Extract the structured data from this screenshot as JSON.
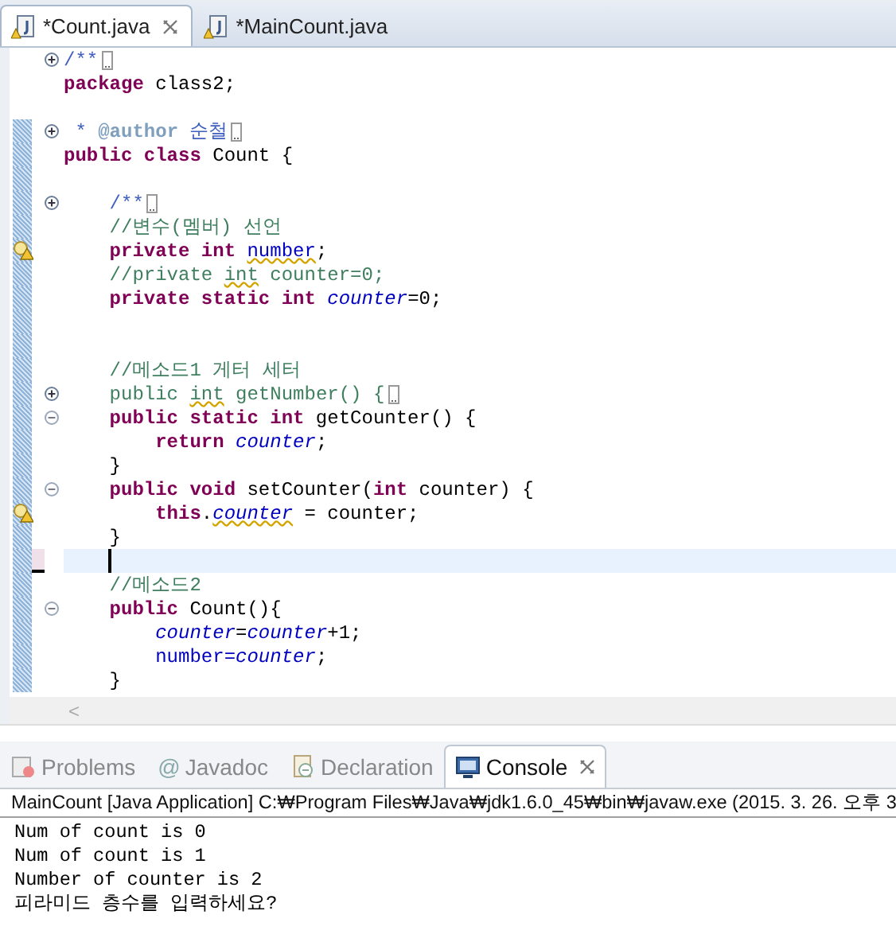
{
  "editor_tabs": [
    {
      "label": "*Count.java",
      "selected": true,
      "closable": true
    },
    {
      "label": "*MainCount.java",
      "selected": false,
      "closable": false
    }
  ],
  "code_lines": [
    {
      "fold": {
        "expanded": false
      },
      "changed": false,
      "tokens": [
        {
          "text": "/**",
          "kind": "javadoc"
        }
      ]
    },
    {
      "changed": false,
      "tokens": [
        {
          "text": "package",
          "kind": "keyword"
        },
        {
          "text": " class2;",
          "kind": "plain"
        }
      ]
    },
    {
      "changed": false
    },
    {
      "fold": {
        "expanded": false
      },
      "changed": true,
      "tokens": [
        {
          "text": " * ",
          "kind": "javadoc"
        },
        {
          "text": "@author",
          "kind": "tag"
        },
        {
          "text": " 순철",
          "kind": "javadoc"
        }
      ]
    },
    {
      "changed": true,
      "tokens": [
        {
          "text": "public class",
          "kind": "keyword"
        },
        {
          "text": " Count {",
          "kind": "plain"
        }
      ]
    },
    {
      "changed": true
    },
    {
      "fold": {
        "expanded": false
      },
      "changed": true,
      "tokens": [
        {
          "text": "    /**",
          "kind": "javadoc"
        }
      ]
    },
    {
      "changed": true,
      "tokens": [
        {
          "text": "    //변수(멤버) 선언",
          "kind": "comment"
        }
      ]
    },
    {
      "changed": true,
      "warning": true,
      "tokens": [
        {
          "text": "    private int ",
          "kind": "keyword"
        },
        {
          "text": "number",
          "kind": "field",
          "squiggle": true
        },
        {
          "text": ";",
          "kind": "plain"
        }
      ]
    },
    {
      "changed": true,
      "tokens": [
        {
          "text": "    //private ",
          "kind": "comment"
        },
        {
          "text": "int",
          "kind": "comment",
          "squiggle": true
        },
        {
          "text": " counter=0;",
          "kind": "comment"
        }
      ]
    },
    {
      "changed": true,
      "tokens": [
        {
          "text": "    private static int ",
          "kind": "keyword"
        },
        {
          "text": "counter",
          "kind": "static"
        },
        {
          "text": "=0;",
          "kind": "plain"
        }
      ]
    },
    {
      "changed": true
    },
    {
      "changed": true
    },
    {
      "changed": true,
      "tokens": [
        {
          "text": "    //메소드1 게터 세터",
          "kind": "comment"
        }
      ]
    },
    {
      "fold": {
        "expanded": false
      },
      "changed": true,
      "tokens": [
        {
          "text": "    public ",
          "kind": "comment"
        },
        {
          "text": "int",
          "kind": "comment",
          "squiggle": true
        },
        {
          "text": " getNumber() {",
          "kind": "comment"
        }
      ]
    },
    {
      "fold": {
        "expanded": true
      },
      "changed": true,
      "tokens": [
        {
          "text": "    public static int",
          "kind": "keyword"
        },
        {
          "text": " getCounter() {",
          "kind": "plain"
        }
      ]
    },
    {
      "changed": true,
      "tokens": [
        {
          "text": "        return ",
          "kind": "keyword"
        },
        {
          "text": "counter",
          "kind": "static"
        },
        {
          "text": ";",
          "kind": "plain"
        }
      ]
    },
    {
      "changed": true,
      "tokens": [
        {
          "text": "    }",
          "kind": "plain"
        }
      ]
    },
    {
      "fold": {
        "expanded": true
      },
      "changed": true,
      "tokens": [
        {
          "text": "    public void",
          "kind": "keyword"
        },
        {
          "text": " setCounter(",
          "kind": "plain"
        },
        {
          "text": "int",
          "kind": "keyword"
        },
        {
          "text": " counter) {",
          "kind": "plain"
        }
      ]
    },
    {
      "changed": true,
      "warning": true,
      "tokens": [
        {
          "text": "        this",
          "kind": "keyword"
        },
        {
          "text": ".",
          "kind": "plain"
        },
        {
          "text": "counter",
          "kind": "static",
          "squiggle": true
        },
        {
          "text": " = counter;",
          "kind": "plain"
        }
      ]
    },
    {
      "changed": true,
      "tokens": [
        {
          "text": "    }",
          "kind": "plain"
        }
      ]
    },
    {
      "changed": true,
      "current": true
    },
    {
      "changed": true,
      "tokens": [
        {
          "text": "    //메소드2",
          "kind": "comment"
        }
      ]
    },
    {
      "fold": {
        "expanded": true
      },
      "changed": true,
      "tokens": [
        {
          "text": "    public",
          "kind": "keyword"
        },
        {
          "text": " Count(){",
          "kind": "plain"
        }
      ]
    },
    {
      "changed": true,
      "tokens": [
        {
          "text": "        counter",
          "kind": "static"
        },
        {
          "text": "=",
          "kind": "plain"
        },
        {
          "text": "counter",
          "kind": "static"
        },
        {
          "text": "+1;",
          "kind": "plain"
        }
      ]
    },
    {
      "changed": true,
      "tokens": [
        {
          "text": "        number=",
          "kind": "field"
        },
        {
          "text": "counter",
          "kind": "static"
        },
        {
          "text": ";",
          "kind": "plain"
        }
      ]
    },
    {
      "changed": true,
      "tokens": [
        {
          "text": "    }",
          "kind": "plain"
        }
      ]
    }
  ],
  "scrollbar": {
    "left_arrow": "<"
  },
  "panel_tabs": [
    {
      "label": "Problems",
      "kind": "problems",
      "selected": false,
      "closable": false
    },
    {
      "label": "Javadoc",
      "kind": "javadoc",
      "glyph": "@",
      "selected": false,
      "closable": false
    },
    {
      "label": "Declaration",
      "kind": "declaration",
      "selected": false,
      "closable": false
    },
    {
      "label": "Console",
      "kind": "console",
      "selected": true,
      "closable": true
    }
  ],
  "console": {
    "header": "MainCount [Java Application] C:₩Program Files₩Java₩jdk1.6.0_45₩bin₩javaw.exe (2015. 3. 26. 오후 3",
    "output": [
      "Num of count is 0",
      "Num of count is 1",
      "Number of counter is 2",
      "피라미드 층수를 입력하세요?"
    ]
  }
}
